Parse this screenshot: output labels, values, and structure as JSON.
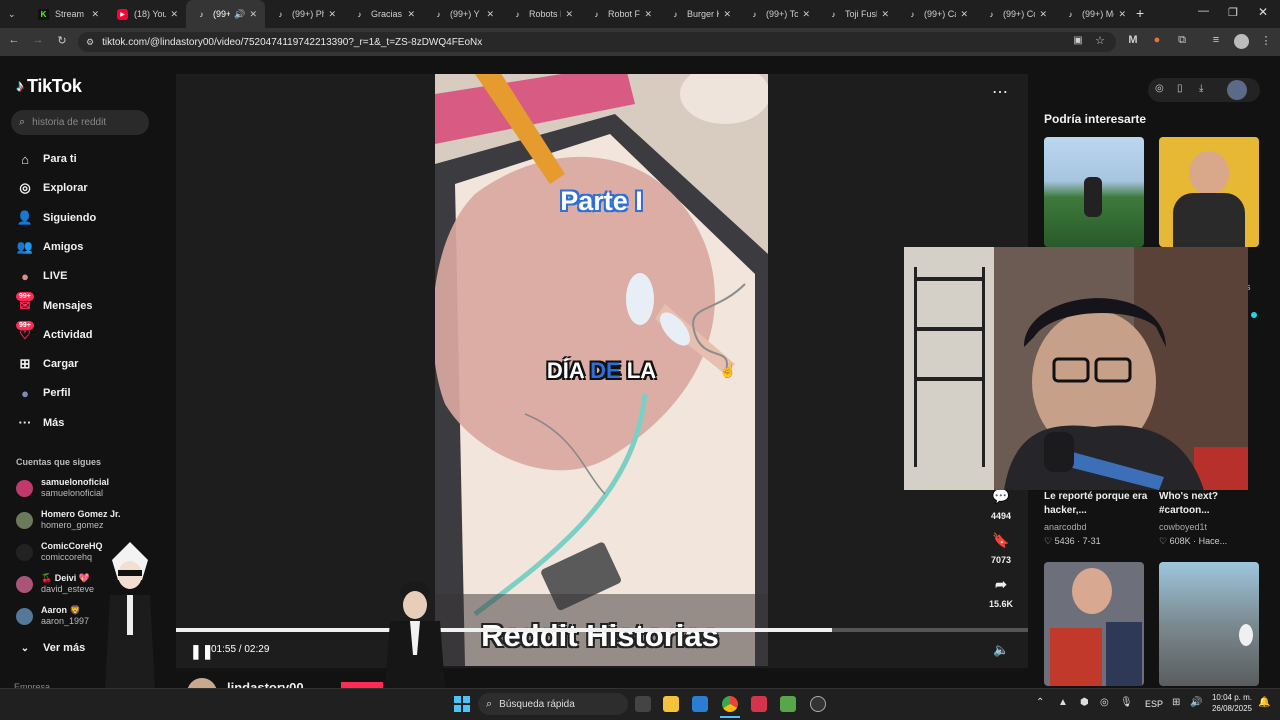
{
  "tabs": [
    {
      "title": "Stream",
      "icon": "kick-icon",
      "color": "#53fc18"
    },
    {
      "title": "(18) YouT",
      "icon": "youtube-icon",
      "color": "#ff0033"
    },
    {
      "title": "(99+",
      "icon": "tiktok-icon",
      "color": "#ffffff",
      "active": true
    },
    {
      "title": "(99+) Phi",
      "icon": "tiktok-icon",
      "color": "#ffffff"
    },
    {
      "title": "Gracias a",
      "icon": "tiktok-icon",
      "color": "#ffffff"
    },
    {
      "title": "(99+) Y M",
      "icon": "tiktok-icon",
      "color": "#ffffff"
    },
    {
      "title": "Robots D",
      "icon": "tiktok-icon",
      "color": "#ffffff"
    },
    {
      "title": "Robot Fe",
      "icon": "tiktok-icon",
      "color": "#ffffff"
    },
    {
      "title": "Burger K",
      "icon": "tiktok-icon",
      "color": "#ffffff"
    },
    {
      "title": "(99+) Toj",
      "icon": "tiktok-icon",
      "color": "#ffffff"
    },
    {
      "title": "Toji Fush",
      "icon": "tiktok-icon",
      "color": "#ffffff"
    },
    {
      "title": "(99+) Cal",
      "icon": "tiktok-icon",
      "color": "#ffffff"
    },
    {
      "title": "(99+) Có",
      "icon": "tiktok-icon",
      "color": "#ffffff"
    },
    {
      "title": "(99+) Me",
      "icon": "tiktok-icon",
      "color": "#ffffff"
    }
  ],
  "browser": {
    "url": "tiktok.com/@lindastory00/video/7520474119742213390?_r=1&_t=ZS-8zDWQ4FEoNx"
  },
  "tiktok": {
    "logo": "TikTok",
    "search_placeholder": "historia de reddit",
    "nav": [
      {
        "label": "Para ti",
        "icon": "home-icon"
      },
      {
        "label": "Explorar",
        "icon": "compass-icon"
      },
      {
        "label": "Siguiendo",
        "icon": "following-icon"
      },
      {
        "label": "Amigos",
        "icon": "friends-icon"
      },
      {
        "label": "LIVE",
        "icon": "live-icon"
      },
      {
        "label": "Mensajes",
        "icon": "messages-icon",
        "badge": "99+"
      },
      {
        "label": "Actividad",
        "icon": "activity-icon",
        "badge": "99+"
      },
      {
        "label": "Cargar",
        "icon": "upload-icon"
      },
      {
        "label": "Perfil",
        "icon": "profile-icon"
      },
      {
        "label": "Más",
        "icon": "more-icon"
      }
    ],
    "following_header": "Cuentas que sigues",
    "following": [
      {
        "name": "samuelonoficial",
        "handle": "samuelonoficial",
        "color": "#c0396b"
      },
      {
        "name": "Homero Gomez Jr.",
        "handle": "homero_gomez",
        "color": "#6a7a5a"
      },
      {
        "name": "ComicCoreHQ",
        "handle": "comiccorehq",
        "color": "#222222"
      },
      {
        "name": "🍒 Deivi 💖",
        "handle": "david_esteve",
        "color": "#aa5577"
      },
      {
        "name": "Aaron 🦁",
        "handle": "aaron_1997",
        "color": "#557799"
      }
    ],
    "see_more": "Ver más",
    "footer_partial": "Empresa",
    "video": {
      "caption_top": "Parte I",
      "caption_mid_1": "DÍA",
      "caption_mid_2": "DE",
      "caption_mid_3": "LA",
      "overlay_title": "Reddit Historias",
      "time": "01:55 / 02:29",
      "progress": 0.77,
      "author": "lindastory00"
    },
    "actions": [
      {
        "icon": "comment-icon",
        "count": "4494"
      },
      {
        "icon": "bookmark-icon",
        "count": "7073"
      },
      {
        "icon": "share-icon",
        "count": "15.6K"
      }
    ],
    "reco_header": "Podría interesarte",
    "reco": [
      {
        "title": "Le reporté porque era hacker,...",
        "author": "anarcodbd",
        "likes": "5436",
        "date": "7-31"
      },
      {
        "title": "Who's next? #cartoon...",
        "author": "cowboyed1t",
        "likes": "608K",
        "date": "Hace..."
      }
    ]
  },
  "taskbar": {
    "search_placeholder": "Búsqueda rápida",
    "lang": "ESP",
    "time": "10:04 p. m.",
    "date": "26/08/2025"
  }
}
